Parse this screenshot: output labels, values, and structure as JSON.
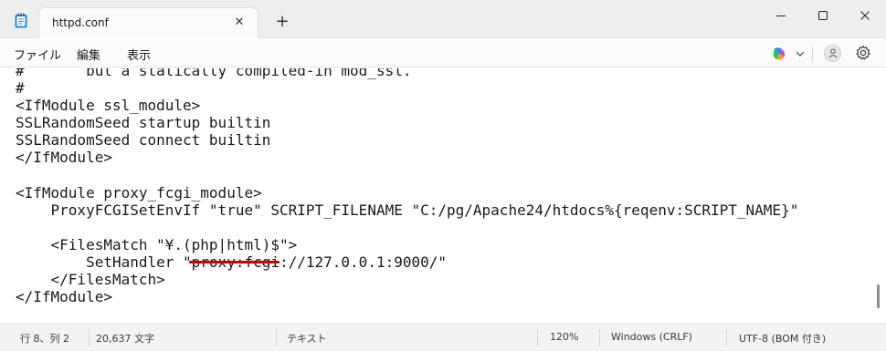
{
  "window": {
    "tab_title": "httpd.conf",
    "tab_close": "✕",
    "new_tab": "+"
  },
  "menu": {
    "file": "ファイル",
    "edit": "編集",
    "view": "表示"
  },
  "editor": {
    "lines": [
      "#       but a statically compiled-in mod_ssl.",
      "#",
      "<IfModule ssl_module>",
      "SSLRandomSeed startup builtin",
      "SSLRandomSeed connect builtin",
      "</IfModule>",
      "",
      "<IfModule proxy_fcgi_module>",
      "    ProxyFCGISetEnvIf \"true\" SCRIPT_FILENAME \"C:/pg/Apache24/htdocs%{reqenv:SCRIPT_NAME}\"",
      "",
      "    <FilesMatch \"¥.(php|html)$\">",
      "        SetHandler \"proxy:fcgi://127.0.0.1:9000/\"",
      "    </FilesMatch>",
      "</IfModule>"
    ],
    "highlight_color": "#cf0000"
  },
  "status": {
    "position": "行 8、列 2",
    "char_count": "20,637 文字",
    "format": "テキスト",
    "zoom": "120%",
    "line_ending": "Windows (CRLF)",
    "encoding": "UTF-8 (BOM 付き)"
  }
}
